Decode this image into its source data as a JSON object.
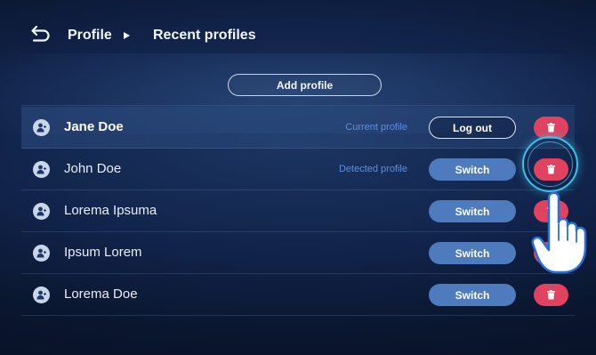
{
  "header": {
    "crumb_1": "Profile",
    "crumb_2": "Recent profiles"
  },
  "actions": {
    "add_profile_label": "Add profile"
  },
  "profiles": [
    {
      "name": "Jane Doe",
      "status": "Current profile",
      "action": "Log out",
      "current": true
    },
    {
      "name": "John Doe",
      "status": "Detected profile",
      "action": "Switch",
      "current": false
    },
    {
      "name": "Lorema Ipsuma",
      "status": "",
      "action": "Switch",
      "current": false
    },
    {
      "name": "Ipsum Lorem",
      "status": "",
      "action": "Switch",
      "current": false
    },
    {
      "name": "Lorema Doe",
      "status": "",
      "action": "Switch",
      "current": false
    }
  ],
  "icons": {
    "back": "back-arrow-icon",
    "separator": "caret-right-icon",
    "avatar": "user-icon",
    "delete": "trash-icon",
    "pointer": "pointing-hand-icon"
  },
  "colors": {
    "background": "#11234a",
    "accent_blue": "#4d7bbd",
    "status_blue": "#5d8fe0",
    "delete_red": "#e0425f",
    "tap_highlight": "#3fc0e8"
  }
}
